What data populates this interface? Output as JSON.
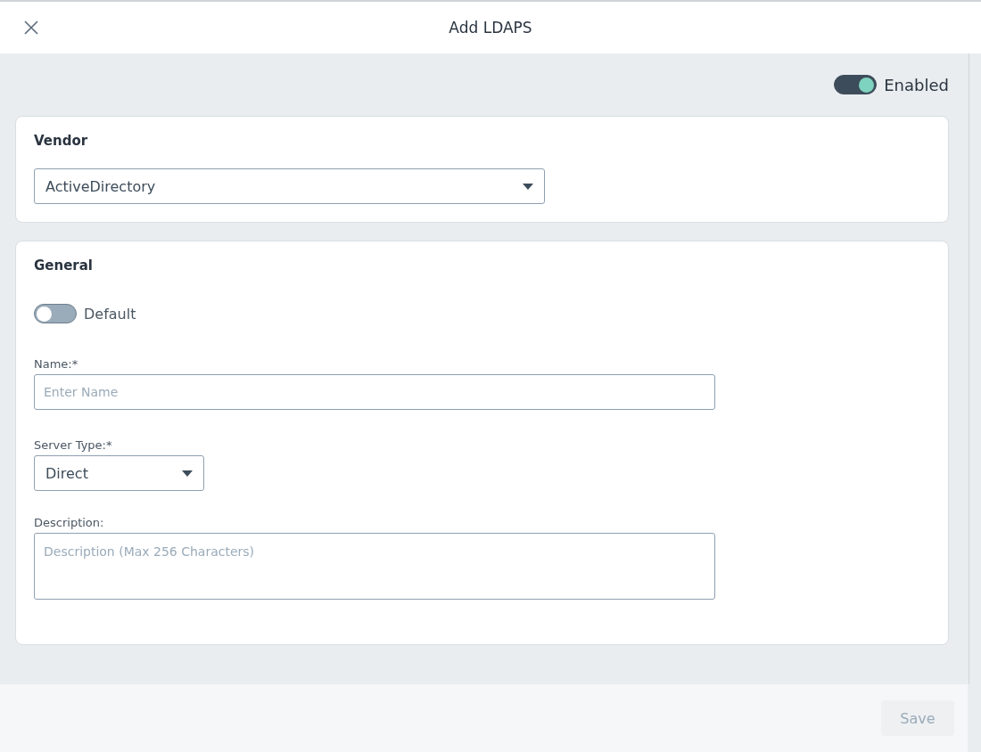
{
  "header": {
    "title": "Add LDAPS"
  },
  "enabled_toggle": {
    "label": "Enabled",
    "on": true
  },
  "vendor": {
    "title": "Vendor",
    "value": "ActiveDirectory"
  },
  "general": {
    "title": "General",
    "default_toggle": {
      "label": "Default",
      "on": false
    },
    "name": {
      "label": "Name:*",
      "placeholder": "Enter Name"
    },
    "server_type": {
      "label": "Server Type:*",
      "value": "Direct"
    },
    "description": {
      "label": "Description:",
      "placeholder": "Description (Max 256 Characters)"
    }
  },
  "footer": {
    "save": {
      "label": "Save",
      "disabled": true
    }
  }
}
